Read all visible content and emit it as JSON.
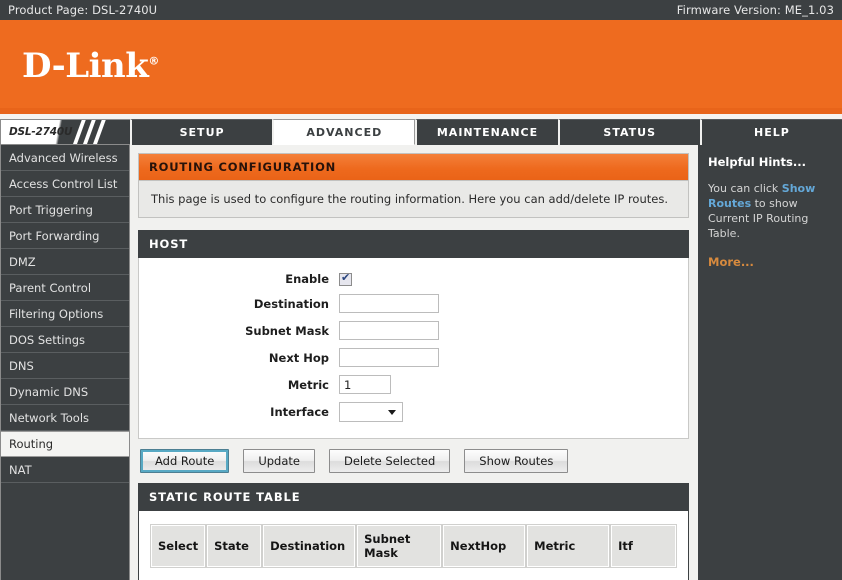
{
  "topbar": {
    "product_page": "Product Page: DSL-2740U",
    "firmware_version": "Firmware Version: ME_1.03"
  },
  "brand": {
    "logo_text": "D-Link",
    "registered_mark": "®",
    "accent_orange": "#ee6b1f",
    "dark_gray": "#3c4042"
  },
  "model_tab": {
    "label": "DSL-2740U"
  },
  "tabs": [
    {
      "label": "SETUP",
      "active": false
    },
    {
      "label": "ADVANCED",
      "active": true
    },
    {
      "label": "MAINTENANCE",
      "active": false
    },
    {
      "label": "STATUS",
      "active": false
    },
    {
      "label": "HELP",
      "active": false
    }
  ],
  "sidebar": {
    "items": [
      {
        "label": "Advanced Wireless",
        "active": false
      },
      {
        "label": "Access Control List",
        "active": false
      },
      {
        "label": "Port Triggering",
        "active": false
      },
      {
        "label": "Port Forwarding",
        "active": false
      },
      {
        "label": "DMZ",
        "active": false
      },
      {
        "label": "Parent Control",
        "active": false
      },
      {
        "label": "Filtering Options",
        "active": false
      },
      {
        "label": "DOS Settings",
        "active": false
      },
      {
        "label": "DNS",
        "active": false
      },
      {
        "label": "Dynamic DNS",
        "active": false
      },
      {
        "label": "Network Tools",
        "active": false
      },
      {
        "label": "Routing",
        "active": true
      },
      {
        "label": "NAT",
        "active": false
      }
    ]
  },
  "main": {
    "panel_title": "ROUTING CONFIGURATION",
    "panel_description": "This page is used to configure the routing information. Here you can add/delete IP routes.",
    "host_section_title": "HOST",
    "form": {
      "enable": {
        "label": "Enable",
        "checked": true
      },
      "destination": {
        "label": "Destination",
        "value": "",
        "placeholder": ""
      },
      "subnet_mask": {
        "label": "Subnet Mask",
        "value": "",
        "placeholder": ""
      },
      "next_hop": {
        "label": "Next Hop",
        "value": "",
        "placeholder": ""
      },
      "metric": {
        "label": "Metric",
        "value": "1",
        "placeholder": ""
      },
      "interface": {
        "label": "Interface",
        "selected": "",
        "options": [
          ""
        ]
      }
    },
    "buttons": [
      {
        "label": "Add Route",
        "focused": true
      },
      {
        "label": "Update",
        "focused": false
      },
      {
        "label": "Delete Selected",
        "focused": false
      },
      {
        "label": "Show Routes",
        "focused": false
      }
    ],
    "table_section_title": "STATIC ROUTE TABLE",
    "table": {
      "columns": [
        "Select",
        "State",
        "Destination",
        "Subnet Mask",
        "NextHop",
        "Metric",
        "Itf"
      ],
      "rows": []
    }
  },
  "hints": {
    "title": "Helpful Hints...",
    "text_before": "You can click ",
    "link": "Show Routes",
    "text_after": " to show Current IP Routing Table.",
    "more": "More..."
  }
}
